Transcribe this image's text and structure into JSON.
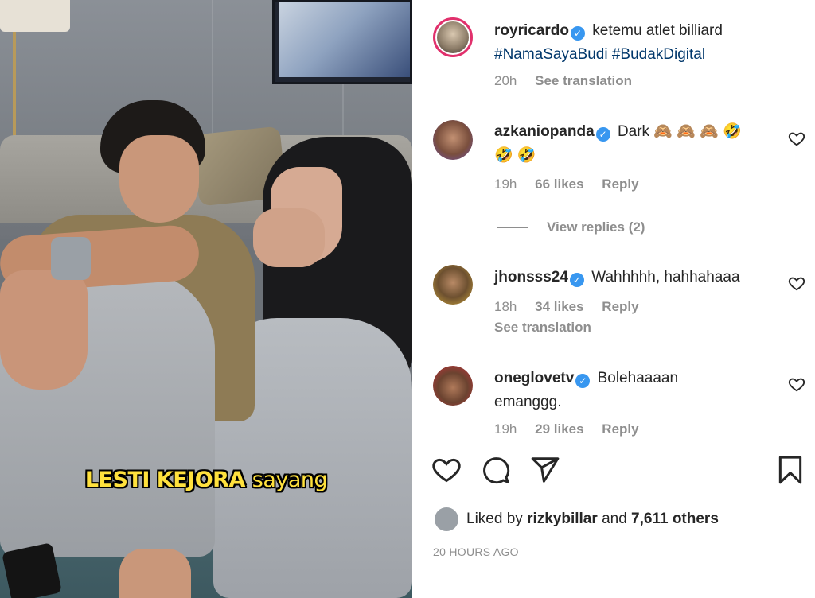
{
  "video": {
    "caption_part1": "LESTI KEJORA",
    "caption_part2": "sayang"
  },
  "post": {
    "username": "royricardo",
    "caption": "ketemu atlet billiard",
    "hashtags": "#NamaSayaBudi #BudakDigital",
    "time": "20h",
    "see_translation": "See translation"
  },
  "comments": [
    {
      "username": "azkaniopanda",
      "text": "Dark 🙈 🙈 🙈 🤣",
      "text2": "🤣 🤣",
      "time": "19h",
      "likes": "66 likes",
      "reply": "Reply",
      "view_replies": "View replies (2)"
    },
    {
      "username": "jhonsss24",
      "text": "Wahhhhh, hahhahaaa",
      "time": "18h",
      "likes": "34 likes",
      "reply": "Reply",
      "see_translation": "See translation"
    },
    {
      "username": "oneglovetv",
      "text": "Bolehaaaan",
      "text2": "emanggg.",
      "time": "19h",
      "likes": "29 likes",
      "reply": "Reply"
    }
  ],
  "likes": {
    "prefix": "Liked by",
    "user": "rizkybillar",
    "and": "and",
    "others": "7,611 others"
  },
  "timestamp": "20 HOURS AGO",
  "icons": [
    "heart-icon",
    "comment-icon",
    "share-icon",
    "bookmark-icon",
    "verified-icon"
  ]
}
